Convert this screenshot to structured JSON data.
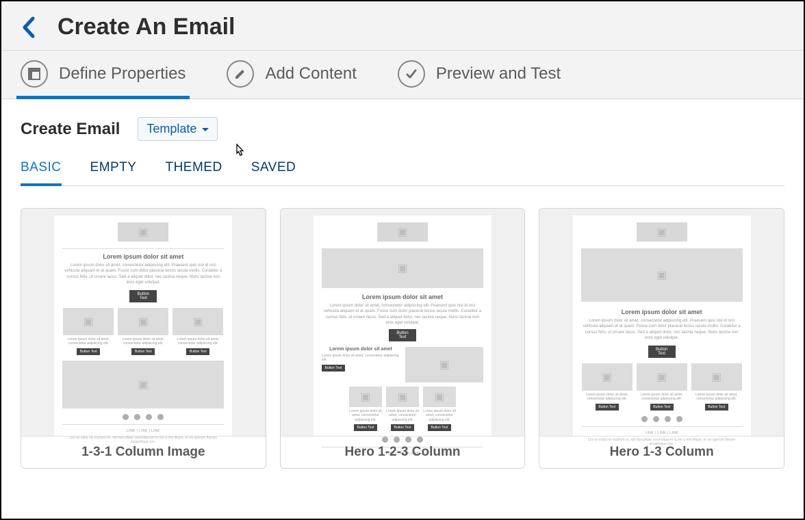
{
  "header": {
    "title": "Create An Email"
  },
  "steps": [
    {
      "label": "Define Properties",
      "active": true
    },
    {
      "label": "Add Content",
      "active": false
    },
    {
      "label": "Preview and Test",
      "active": false
    }
  ],
  "create": {
    "heading": "Create Email",
    "templateButton": "Template"
  },
  "tabs": [
    {
      "label": "BASIC",
      "active": true
    },
    {
      "label": "EMPTY",
      "active": false
    },
    {
      "label": "THEMED",
      "active": false
    },
    {
      "label": "SAVED",
      "active": false
    }
  ],
  "cards": [
    {
      "title": "1-3-1 Column Image"
    },
    {
      "title": "Hero 1-2-3 Column"
    },
    {
      "title": "Hero 1-3 Column"
    }
  ],
  "mock": {
    "heading": "Lorem ipsum dolor sit amet",
    "para": "Lorem ipsum dolor sit amet, consectetur adipiscing elit. Praesent quis nisi id orci vehicula aliquam et at quam. Fusce cum dolor placerat lectus iacula mollis. Curabitur a cursus felis, ut ornare lacus. Sed a aliquet dolor, nec lacinia neque. Nunc lacinia non eros eget volutpat.",
    "btn": "Button Text",
    "colText": "Lorem ipsum dolor sit amet, consectetur adipiscing elit.",
    "links": "LINK  |  LINK  |  LINK",
    "footer": "Qui as eatia nis expliant es. Itat fasculliate ossendipsum fu me a min Illique, te vis aperum flanam ipsapelique con."
  },
  "colors": {
    "accent": "#0b74c4",
    "link": "#0b5cab"
  }
}
